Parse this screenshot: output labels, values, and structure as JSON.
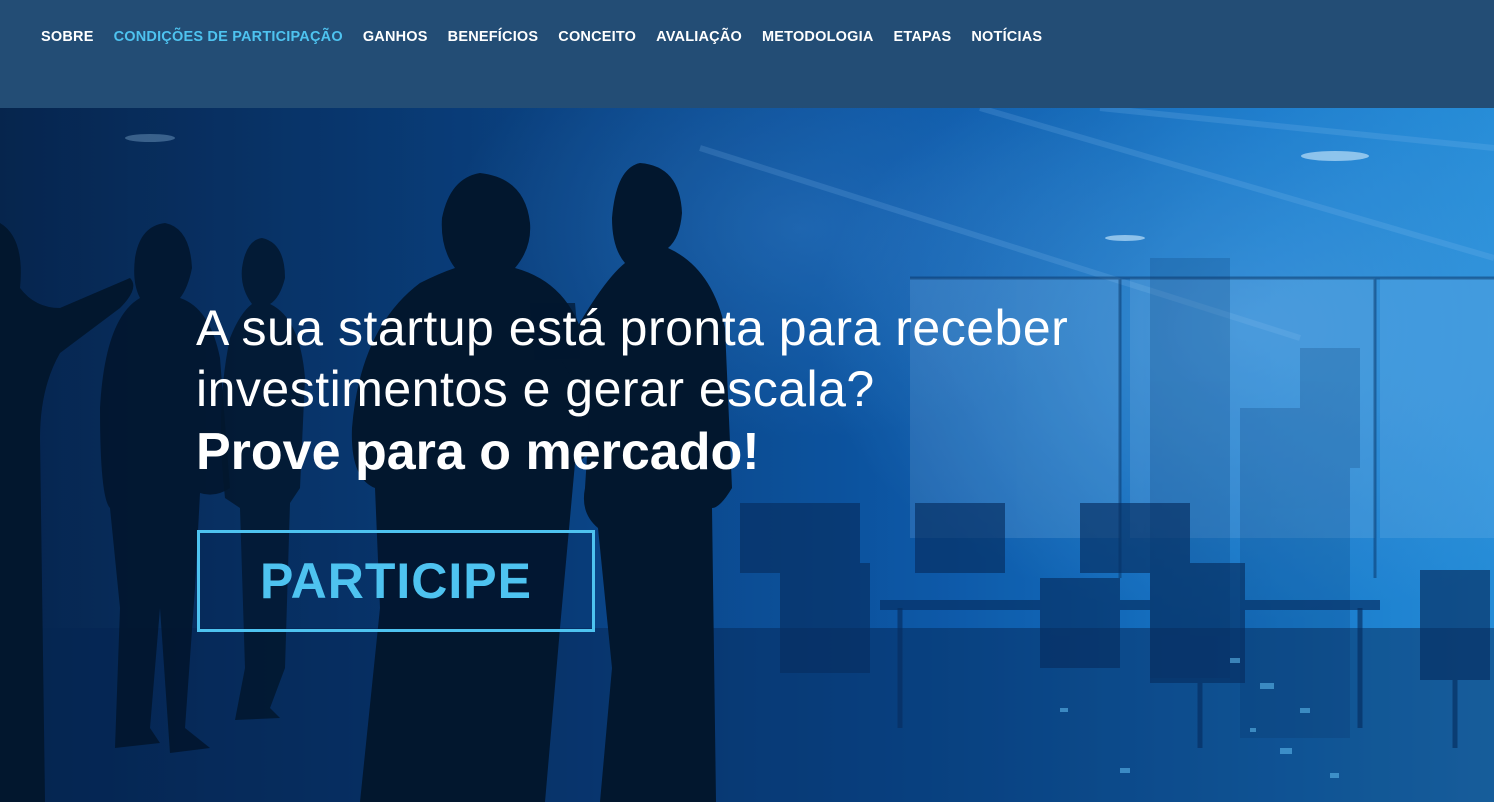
{
  "nav": {
    "items": [
      {
        "label": "SOBRE",
        "active": false
      },
      {
        "label": "CONDIÇÕES DE PARTICIPAÇÃO",
        "active": true
      },
      {
        "label": "GANHOS",
        "active": false
      },
      {
        "label": "BENEFÍCIOS",
        "active": false
      },
      {
        "label": "CONCEITO",
        "active": false
      },
      {
        "label": "AVALIAÇÃO",
        "active": false
      },
      {
        "label": "METODOLOGIA",
        "active": false
      },
      {
        "label": "ETAPAS",
        "active": false
      },
      {
        "label": "NOTÍCIAS",
        "active": false
      }
    ]
  },
  "hero": {
    "headline_line1": "A sua startup está pronta para receber",
    "headline_line2": "investimentos e gerar escala?",
    "headline_emphasis": "Prove para o mercado!",
    "cta_label": "PARTICIPE",
    "image": "business-people-silhouettes-office"
  },
  "colors": {
    "topbar_bg": "#234d75",
    "active_nav": "#4ec3f0",
    "cta_accent": "#4ec3f0",
    "text": "#ffffff"
  }
}
